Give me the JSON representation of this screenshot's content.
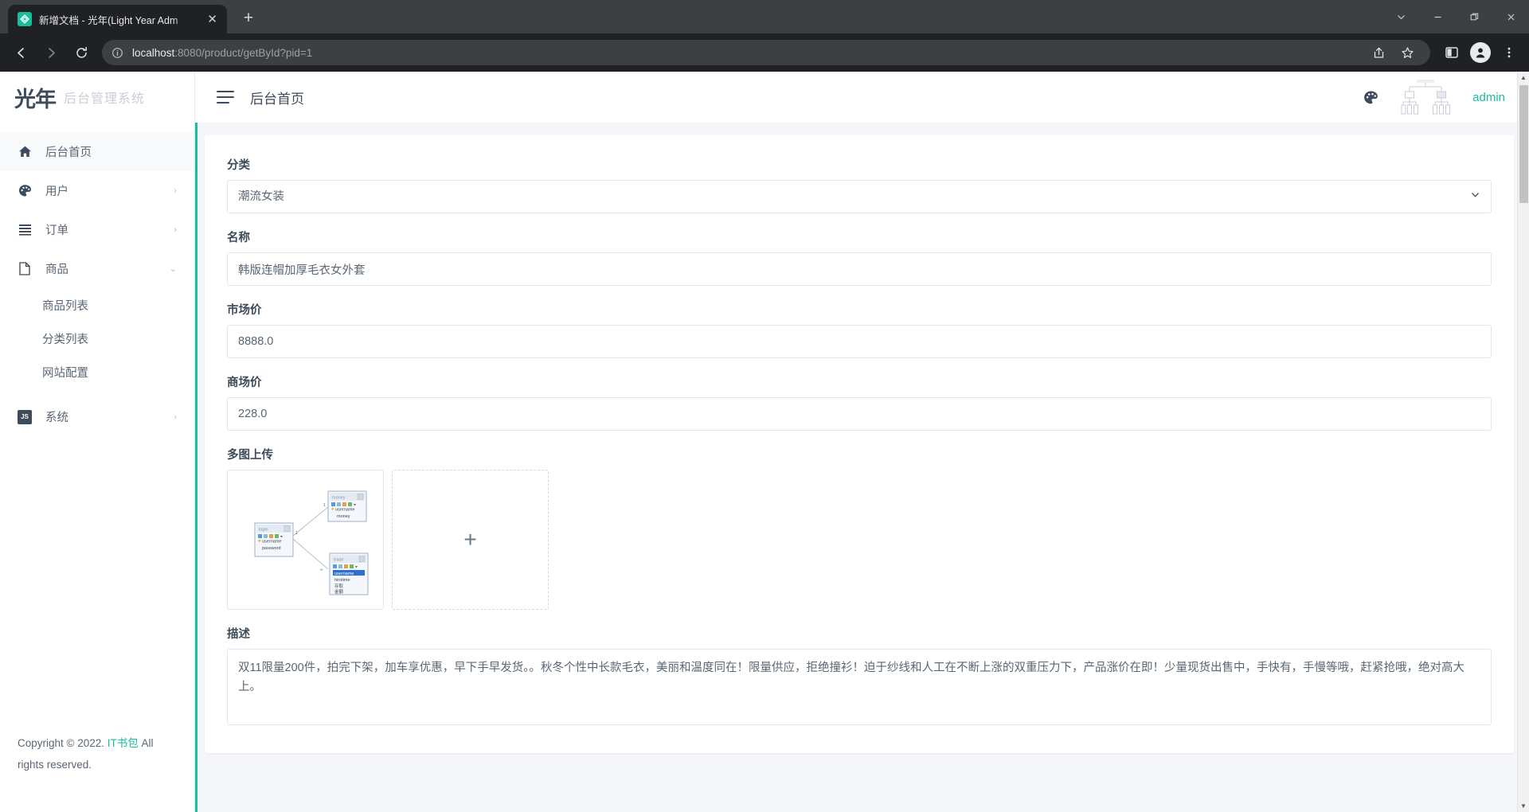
{
  "browser": {
    "tab": {
      "title": "新增文档 - 光年(Light Year Adm",
      "close_label": "✕",
      "favicon_name": "lightyear-favicon"
    },
    "newtab_label": "+",
    "window_controls": {
      "minimize": "—",
      "restore": "❐",
      "close": "✕",
      "chevron": "⌄"
    },
    "nav": {
      "back": "←",
      "forward": "→",
      "reload": "⟳"
    },
    "omnibox": {
      "url_host": "localhost",
      "url_rest": ":8080/product/getById?pid=1",
      "value": "localhost:8080/product/getById?pid=1"
    }
  },
  "sidebar": {
    "brand": {
      "logo": "光年",
      "subtitle": "后台管理系统"
    },
    "items": [
      {
        "label": "后台首页",
        "icon": "home-icon",
        "active": true,
        "caret": ""
      },
      {
        "label": "用户",
        "icon": "palette-icon",
        "active": false,
        "caret": "›"
      },
      {
        "label": "订单",
        "icon": "list-icon",
        "active": false,
        "caret": "›"
      },
      {
        "label": "商品",
        "icon": "file-icon",
        "active": false,
        "caret": "⌄"
      }
    ],
    "submenu": [
      {
        "label": "商品列表"
      },
      {
        "label": "分类列表"
      },
      {
        "label": "网站配置"
      }
    ],
    "system": {
      "label": "系统",
      "icon": "js-badge-icon",
      "badge": "JS",
      "caret": "›"
    },
    "footer": {
      "prefix": "Copyright © 2022. ",
      "link": "IT书包",
      "suffix": " All rights reserved."
    }
  },
  "topbar": {
    "menu_toggle": "hamburger-icon",
    "title": "后台首页",
    "theme_icon": "palette-icon",
    "avatar_icon": "org-chart-avatar",
    "user": "admin"
  },
  "form": {
    "category": {
      "label": "分类",
      "value": "潮流女装",
      "options": [
        "潮流女装"
      ]
    },
    "name": {
      "label": "名称",
      "value": "韩版连帽加厚毛衣女外套"
    },
    "market_price": {
      "label": "市场价",
      "value": "8888.0"
    },
    "mall_price": {
      "label": "商场价",
      "value": "228.0"
    },
    "upload": {
      "label": "多图上传",
      "add_label": "+",
      "thumbnail": {
        "name": "er-diagram-thumbnail",
        "tables": [
          {
            "title": "login",
            "fields": [
              "username",
              "password"
            ]
          },
          {
            "title": "money",
            "fields": [
              "username",
              "money"
            ]
          },
          {
            "title": "trade",
            "fields": [
              "username",
              "hirotime",
              "存取",
              "金额"
            ]
          }
        ],
        "edge_labels": [
          "1",
          "1"
        ]
      }
    },
    "description": {
      "label": "描述",
      "value": "双11限量200件，拍完下架，加车享优惠，早下手早发货。。秋冬个性中长款毛衣，美丽和温度同在！限量供应，拒绝撞衫！迫于纱线和人工在不断上涨的双重压力下，产品涨价在即！少量现货出售中，手快有，手慢等哦，赶紧抢哦，绝对高大上。"
    }
  },
  "scrollbar": {
    "up": "▲",
    "down": "▼"
  },
  "colors": {
    "accent": "#1abc9c",
    "text": "#3e4b5b",
    "muted": "#5a6673"
  }
}
